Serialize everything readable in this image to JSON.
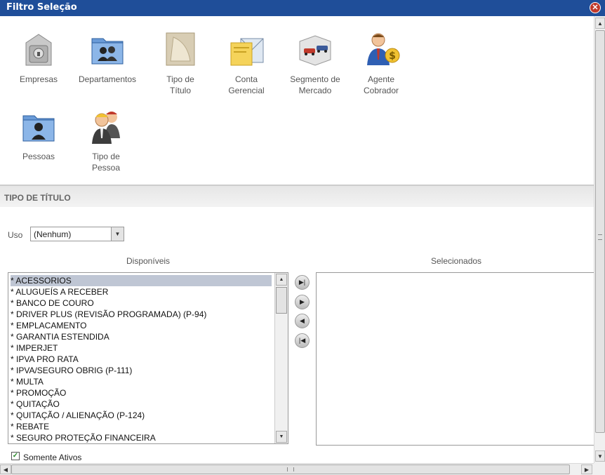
{
  "window": {
    "title": "Filtro Seleção",
    "close_symbol": "✕"
  },
  "icons": [
    {
      "label": "Empresas",
      "icon": "safe-icon"
    },
    {
      "label": "Departamentos",
      "icon": "folder-users-icon"
    },
    {
      "label": "Tipo de Título",
      "icon": "document-icon"
    },
    {
      "label": "Conta Gerencial",
      "icon": "envelope-icon"
    },
    {
      "label": "Segmento de Mercado",
      "icon": "cars-icon"
    },
    {
      "label": "Agente Cobrador",
      "icon": "agent-money-icon"
    },
    {
      "label": "Pessoas",
      "icon": "folder-person-icon"
    },
    {
      "label": "Tipo de Pessoa",
      "icon": "workers-icon"
    }
  ],
  "section": {
    "title": "TIPO DE TÍTULO"
  },
  "uso": {
    "label": "Uso",
    "selected": "(Nenhum)"
  },
  "disponiveis": {
    "title": "Disponíveis",
    "items": [
      "* ACESSORIOS",
      "* ALUGUEÍS A RECEBER",
      "* BANCO DE COURO",
      "* DRIVER PLUS (REVISÃO PROGRAMADA) (P-94)",
      "* EMPLACAMENTO",
      "* GARANTIA ESTENDIDA",
      "* IMPERJET",
      "* IPVA PRO RATA",
      "* IPVA/SEGURO OBRIG (P-111)",
      "* MULTA",
      "* PROMOÇÃO",
      "* QUITAÇÃO",
      "* QUITAÇÃO / ALIENAÇÃO (P-124)",
      "* REBATE",
      "* SEGURO PROTEÇÃO FINANCEIRA"
    ],
    "selected_index": 0
  },
  "selecionados": {
    "title": "Selecionados",
    "items": []
  },
  "move_buttons": [
    "move-all-right",
    "move-right",
    "move-left",
    "move-all-left"
  ],
  "somente_ativos": {
    "label": "Somente Ativos",
    "checked": true
  },
  "colors": {
    "titlebar": "#1f4e99",
    "selected_row": "#bfc6d4",
    "section_bg": "#ececec"
  }
}
